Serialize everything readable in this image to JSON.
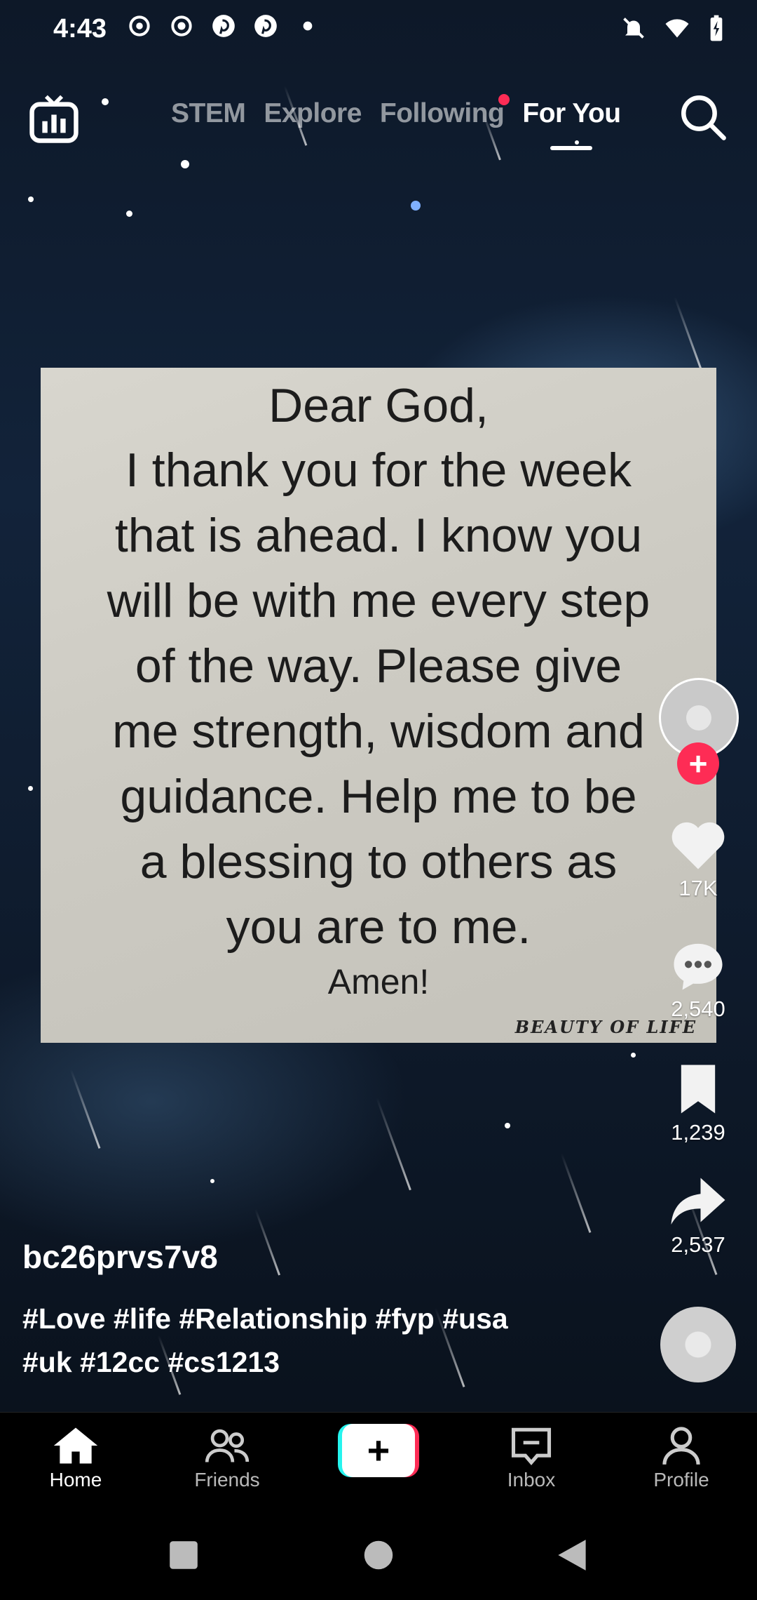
{
  "status_bar": {
    "time": "4:43",
    "notification_icons": [
      "threads-icon",
      "circle-icon",
      "pinterest-icon",
      "pinterest-icon",
      "dot-icon"
    ],
    "system_icons": [
      "mute-icon",
      "wifi-icon",
      "battery-charging-icon"
    ]
  },
  "top_nav": {
    "tabs": [
      {
        "label": "STEM",
        "active": false
      },
      {
        "label": "Explore",
        "active": false
      },
      {
        "label": "Following",
        "active": false,
        "has_dot": true
      },
      {
        "label": "For You",
        "active": true
      }
    ]
  },
  "video": {
    "quote_title": "Dear God,",
    "quote_lines": [
      "I thank you for the week",
      "that is ahead. I know you",
      "will be with me every step",
      "of the way. Please give",
      "me strength, wisdom and",
      "guidance. Help me to be",
      "a blessing to others as",
      "you are to me."
    ],
    "quote_closing": "Amen!",
    "watermark": "BEAUTY OF LIFE"
  },
  "actions": {
    "likes": "17K",
    "comments": "2,540",
    "saves": "1,239",
    "shares": "2,537"
  },
  "caption": {
    "username": "bc26prvs7v8",
    "hashtags_line1": "#Love #life #Relationship #fyp #usa",
    "hashtags_line2": "#uk #12cc #cs1213"
  },
  "bottom_nav": {
    "home": "Home",
    "friends": "Friends",
    "create": "+",
    "inbox": "Inbox",
    "profile": "Profile"
  },
  "colors": {
    "accent": "#fe2c55",
    "accent_secondary": "#25f4ee"
  }
}
